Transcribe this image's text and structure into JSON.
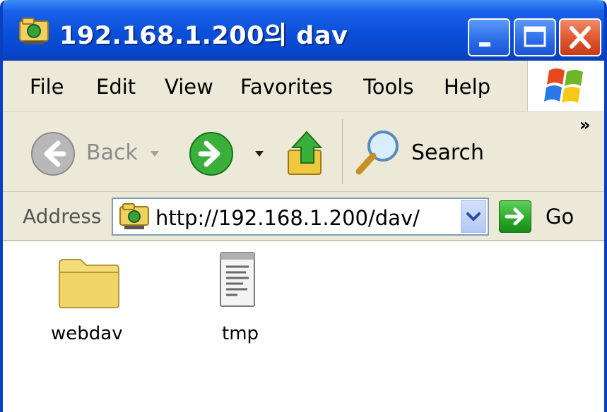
{
  "window": {
    "title": "192.168.1.200의 dav",
    "colors": {
      "title_bar": "#0a4fd8",
      "chrome": "#ece9d8",
      "close": "#e05a30",
      "go": "#2aa828"
    }
  },
  "menu": {
    "items": [
      "File",
      "Edit",
      "View",
      "Favorites",
      "Tools",
      "Help"
    ]
  },
  "toolbar": {
    "back_label": "Back",
    "search_label": "Search",
    "overflow": "»"
  },
  "address": {
    "label": "Address",
    "value": "http://192.168.1.200/dav/",
    "go_label": "Go"
  },
  "files": [
    {
      "name": "webdav",
      "icon": "folder-icon"
    },
    {
      "name": "tmp",
      "icon": "text-file-icon"
    }
  ]
}
